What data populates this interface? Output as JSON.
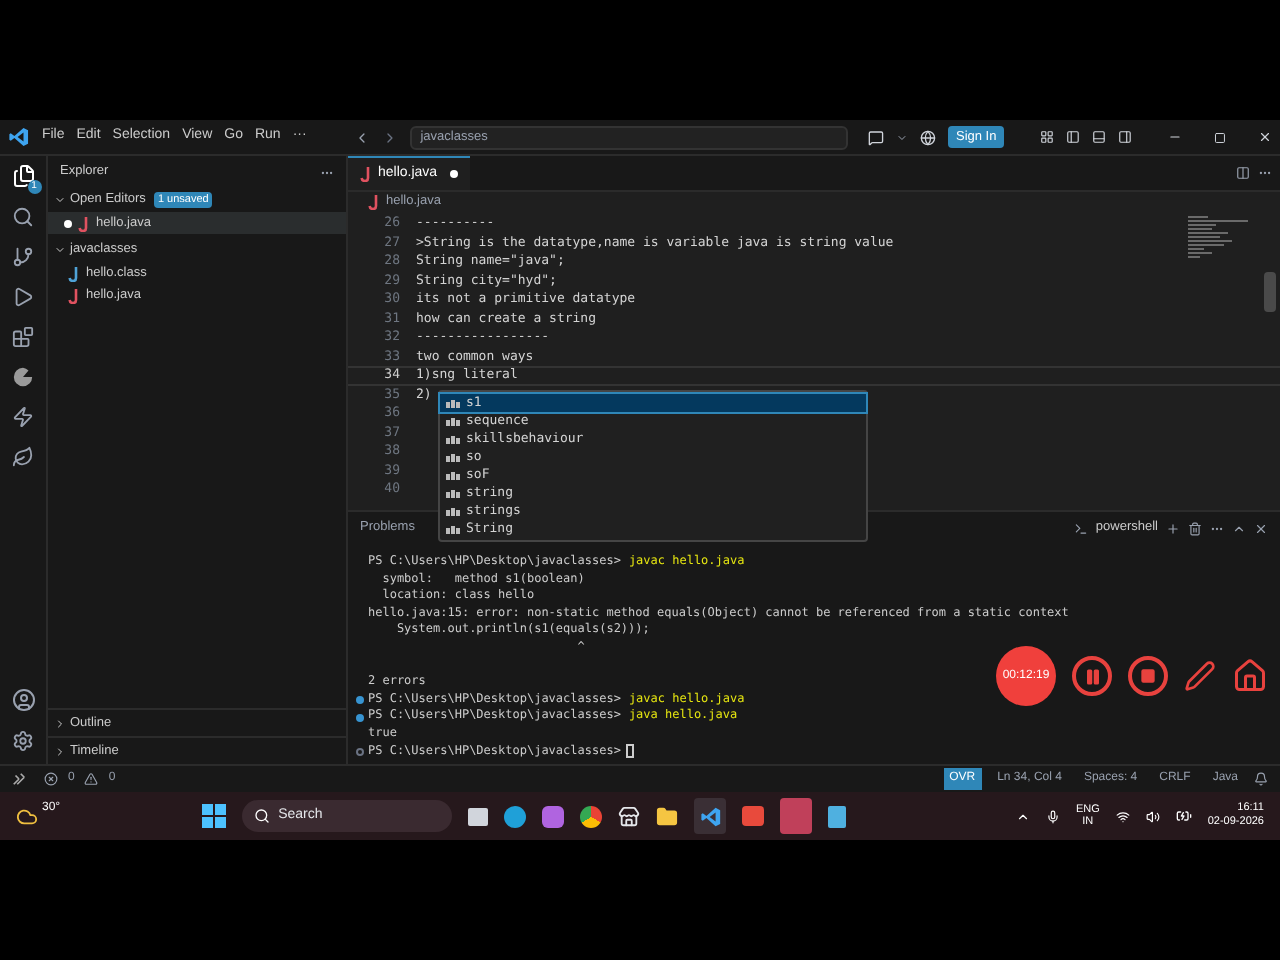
{
  "title_bar": {
    "menu": [
      "File",
      "Edit",
      "Selection",
      "View",
      "Go",
      "Run"
    ],
    "more": "···",
    "search": "javaclasses",
    "sign_in": "Sign In"
  },
  "activity_bar": {
    "badge": "1"
  },
  "sidebar": {
    "title": "Explorer",
    "open_editors": {
      "label": "Open Editors",
      "badge": "1 unsaved",
      "expanded": true,
      "files": [
        {
          "name": "hello.java",
          "kind": "java",
          "unsaved": true,
          "selected": true
        }
      ]
    },
    "folder": {
      "label": "javaclasses",
      "expanded": true,
      "files": [
        {
          "name": "hello.class",
          "kind": "class",
          "unsaved": false,
          "selected": false
        },
        {
          "name": "hello.java",
          "kind": "java",
          "unsaved": false,
          "selected": false
        }
      ]
    },
    "sections": [
      {
        "label": "Outline",
        "expanded": false
      },
      {
        "label": "Timeline",
        "expanded": false
      }
    ]
  },
  "editor": {
    "tab": {
      "label": "hello.java",
      "unsaved": true
    },
    "breadcrumb": "hello.java",
    "lines": [
      {
        "number": "26",
        "text": "----------"
      },
      {
        "number": "27",
        "text": ">String is the datatype,name is variable java is string value"
      },
      {
        "number": "28",
        "text": "String name=\"java\";"
      },
      {
        "number": "29",
        "text": "String city=\"hyd\";"
      },
      {
        "number": "30",
        "text": "its not a primitive datatype"
      },
      {
        "number": "31",
        "text": "how can create a string"
      },
      {
        "number": "32",
        "text": "-----------------"
      },
      {
        "number": "33",
        "text": "two common ways"
      },
      {
        "number": "34",
        "text": "1)sng literal",
        "current": true
      },
      {
        "number": "35",
        "text": "2)"
      },
      {
        "number": "36"
      },
      {
        "number": "37"
      },
      {
        "number": "38"
      },
      {
        "number": "39"
      },
      {
        "number": "40"
      }
    ],
    "suggestions": [
      {
        "label": "s1",
        "selected": true
      },
      {
        "label": "sequence",
        "selected": false
      },
      {
        "label": "skillsbehaviour",
        "selected": false
      },
      {
        "label": "so",
        "selected": false
      },
      {
        "label": "soF",
        "selected": false
      },
      {
        "label": "string",
        "selected": false
      },
      {
        "label": "strings",
        "selected": false
      },
      {
        "label": "String",
        "selected": false
      }
    ]
  },
  "panel": {
    "tab": "Problems",
    "shell": "powershell",
    "lines": [
      {
        "kind": "prompt",
        "prompt": "PS C:\\Users\\HP\\Desktop\\javaclasses>",
        "command": "javac hello.java"
      },
      {
        "kind": "output",
        "text": "  symbol:   method s1(boolean)"
      },
      {
        "kind": "output",
        "text": "  location: class hello"
      },
      {
        "kind": "output",
        "text": "hello.java:15: error: non-static method equals(Object) cannot be referenced from a static context"
      },
      {
        "kind": "output",
        "text": "    System.out.println(s1(equals(s2)));"
      },
      {
        "kind": "output",
        "text": "                             ^"
      },
      {
        "kind": "blank"
      },
      {
        "kind": "output",
        "text": "2 errors"
      },
      {
        "kind": "prompt_done",
        "prompt": "PS C:\\Users\\HP\\Desktop\\javaclasses>",
        "command": "javac hello.java"
      },
      {
        "kind": "prompt_done",
        "prompt": "PS C:\\Users\\HP\\Desktop\\javaclasses>",
        "command": "java hello.java"
      },
      {
        "kind": "output",
        "text": "true"
      },
      {
        "kind": "prompt_idle",
        "prompt": "PS C:\\Users\\HP\\Desktop\\javaclasses>"
      }
    ]
  },
  "recorder": {
    "timer": "00:12:19"
  },
  "status_bar": {
    "errors": "0",
    "warnings": "0",
    "items": [
      {
        "label": "OVR",
        "highlighted": true
      },
      {
        "label": "Ln 34, Col 4",
        "highlighted": false
      },
      {
        "label": "Spaces: 4",
        "highlighted": false
      },
      {
        "label": "CRLF",
        "highlighted": false
      },
      {
        "label": "Java",
        "highlighted": false
      }
    ]
  },
  "taskbar": {
    "weather": "30°",
    "search": "Search",
    "language": "ENG",
    "region": "IN",
    "time": "16:11",
    "date": "02-09-2026"
  }
}
